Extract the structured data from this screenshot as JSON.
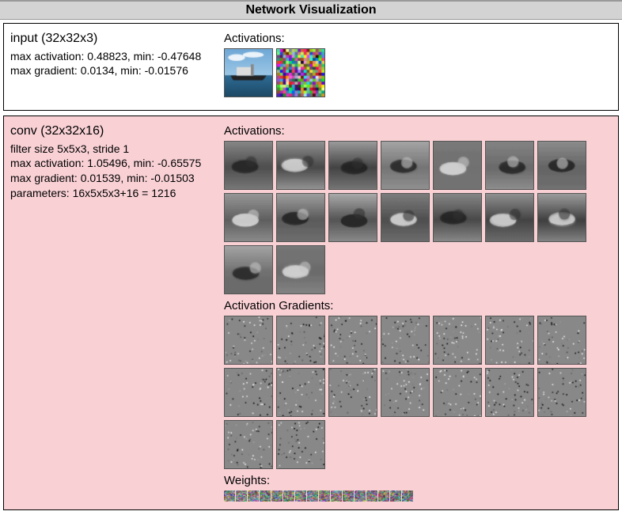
{
  "title": "Network Visualization",
  "labels": {
    "activations": "Activations:",
    "grads": "Activation Gradients:",
    "weights": "Weights:"
  },
  "input_layer": {
    "title": "input (32x32x3)",
    "line1": "max activation: 0.48823, min: -0.47648",
    "line2": "max gradient: 0.0134, min: -0.01576",
    "activation_count": 2
  },
  "conv_layer": {
    "title": "conv (32x32x16)",
    "line1": "filter size 5x5x3, stride 1",
    "line2": "max activation: 1.05496, min: -0.65575",
    "line3": "max gradient: 0.01539, min: -0.01503",
    "line4": "parameters: 16x5x5x3+16 = 1216",
    "activation_count": 16,
    "gradient_count": 16,
    "weight_count": 16
  }
}
